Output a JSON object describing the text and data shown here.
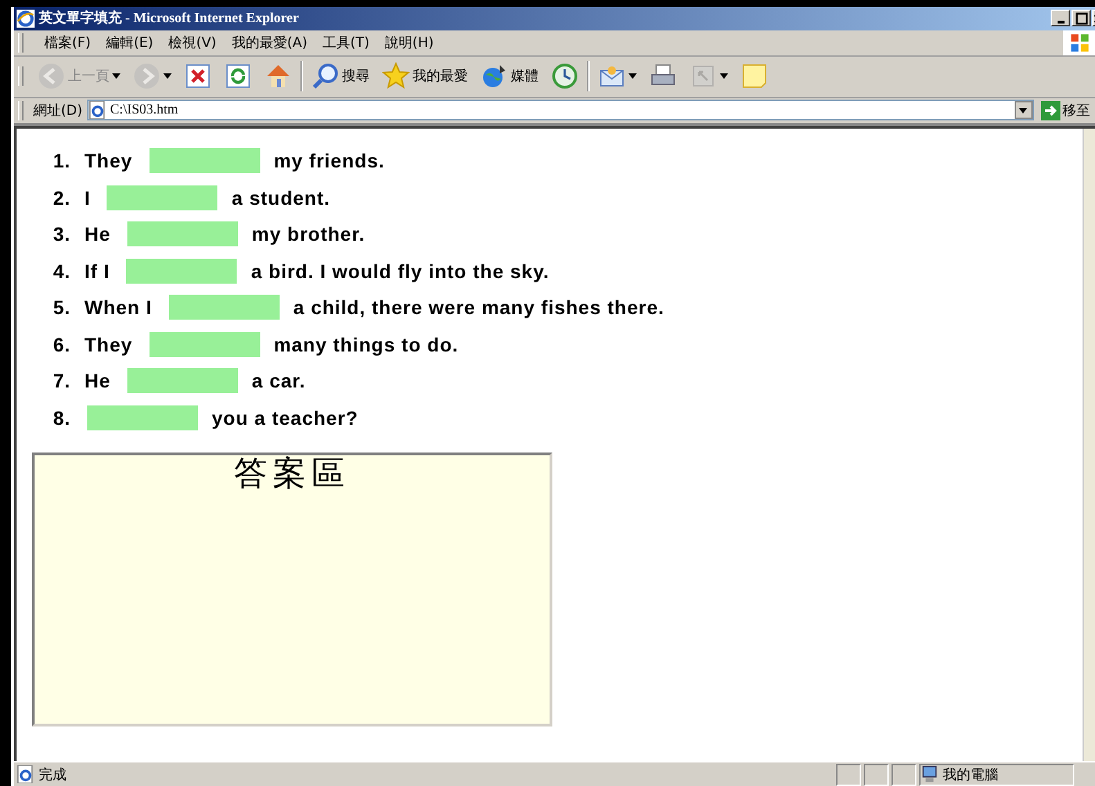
{
  "window": {
    "title": "英文單字填充 - Microsoft Internet Explorer"
  },
  "menu": [
    "檔案(F)",
    "編輯(E)",
    "檢視(V)",
    "我的最愛(A)",
    "工具(T)",
    "說明(H)"
  ],
  "toolbar": [
    {
      "kind": "back",
      "label": "上一頁",
      "disabled": true,
      "dropdown": true
    },
    {
      "kind": "forward",
      "disabled": true,
      "dropdown": true
    },
    {
      "kind": "stop",
      "disabled": false,
      "dropdown": false
    },
    {
      "kind": "refresh",
      "disabled": false,
      "dropdown": false
    },
    {
      "kind": "home",
      "disabled": false,
      "dropdown": false
    },
    {
      "kind": "search",
      "label": "搜尋",
      "disabled": false,
      "dropdown": false
    },
    {
      "kind": "favorites",
      "label": "我的最愛",
      "disabled": false,
      "dropdown": false
    },
    {
      "kind": "media",
      "label": "媒體",
      "disabled": false,
      "dropdown": false
    },
    {
      "kind": "history",
      "disabled": false,
      "dropdown": false
    },
    {
      "kind": "mail",
      "disabled": false,
      "dropdown": true
    },
    {
      "kind": "print",
      "disabled": false,
      "dropdown": false
    },
    {
      "kind": "edit",
      "disabled": true,
      "dropdown": true
    },
    {
      "kind": "note",
      "disabled": false,
      "dropdown": false
    }
  ],
  "address": {
    "label": "網址(D)",
    "value": "C:\\IS03.htm",
    "go": "移至"
  },
  "exercises": [
    {
      "number": "1.",
      "before": "They",
      "after": "my friends."
    },
    {
      "number": "2.",
      "before": "I",
      "after": "a student."
    },
    {
      "number": "3.",
      "before": "He",
      "after": "my brother."
    },
    {
      "number": "4.",
      "before": "If I",
      "after": "a bird. I would fly into the sky."
    },
    {
      "number": "5.",
      "before": "When I",
      "after": "a child, there were many fishes there."
    },
    {
      "number": "6.",
      "before": "They",
      "after": "many things to do."
    },
    {
      "number": "7.",
      "before": "He",
      "after": "a car."
    },
    {
      "number": "8.",
      "after": "you a teacher?"
    }
  ],
  "answer_area": {
    "title": "答案區"
  },
  "status_bar": {
    "text": "完成",
    "zone": "我的電腦"
  }
}
